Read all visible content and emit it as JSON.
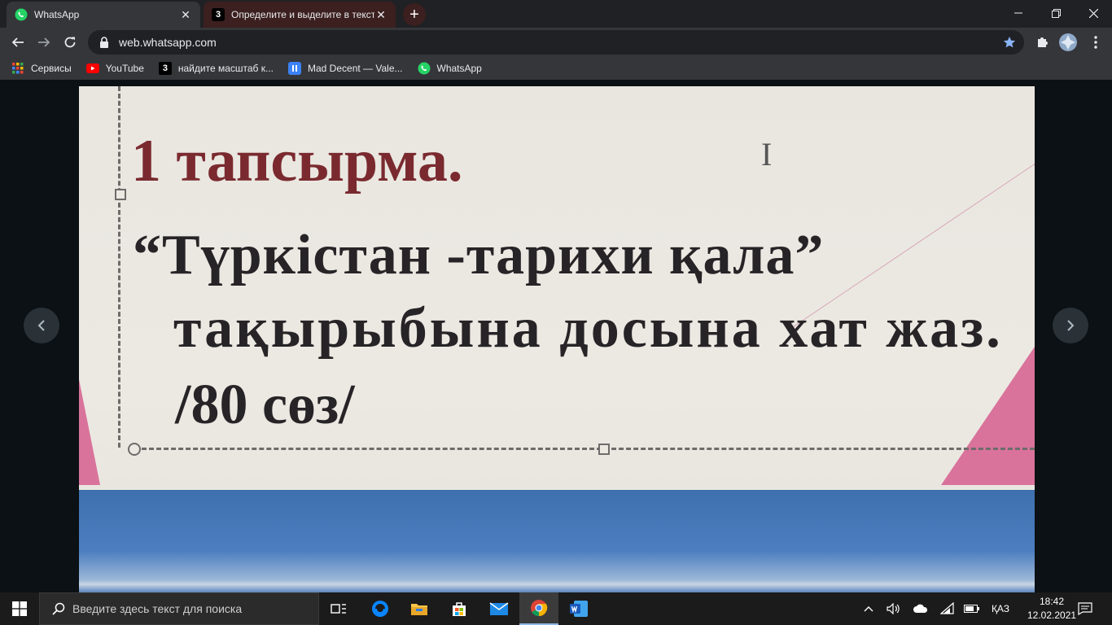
{
  "browser": {
    "tabs": [
      {
        "label": "WhatsApp",
        "active": true,
        "icon": "whatsapp-icon"
      },
      {
        "label": "Определите и выделите в текст",
        "active": false,
        "icon": "znanija-icon",
        "icon_text": "3"
      }
    ],
    "new_tab_symbol": "+",
    "window_controls": {
      "minimize": "—",
      "maximize": "❐",
      "close": "✕"
    },
    "url": "web.whatsapp.com",
    "bookmarks": [
      {
        "label": "Сервисы",
        "icon": "apps-grid-icon"
      },
      {
        "label": "YouTube",
        "icon": "youtube-icon"
      },
      {
        "label": "найдите масштаб к...",
        "icon": "znanija-icon",
        "icon_text": "3"
      },
      {
        "label": "Mad Decent — Vale...",
        "icon": "pause-icon"
      },
      {
        "label": "WhatsApp",
        "icon": "whatsapp-icon"
      }
    ]
  },
  "viewer": {
    "lines": [
      "1 тапсырма.",
      "“Түркістан -тарихи қала”",
      "тақырыбына досына хат жаз.",
      "/80 сөз/"
    ],
    "cursor_glyph": "I"
  },
  "taskbar": {
    "search_placeholder": "Введите здесь текст для поиска",
    "language": "ҚАЗ",
    "time": "18:42",
    "date": "12.02.2021"
  },
  "colors": {
    "whatsapp_green": "#25d366",
    "youtube_red": "#ff0000",
    "title_red": "#7a2a2f",
    "chrome_dark": "#202124",
    "toolbar": "#35363a"
  }
}
